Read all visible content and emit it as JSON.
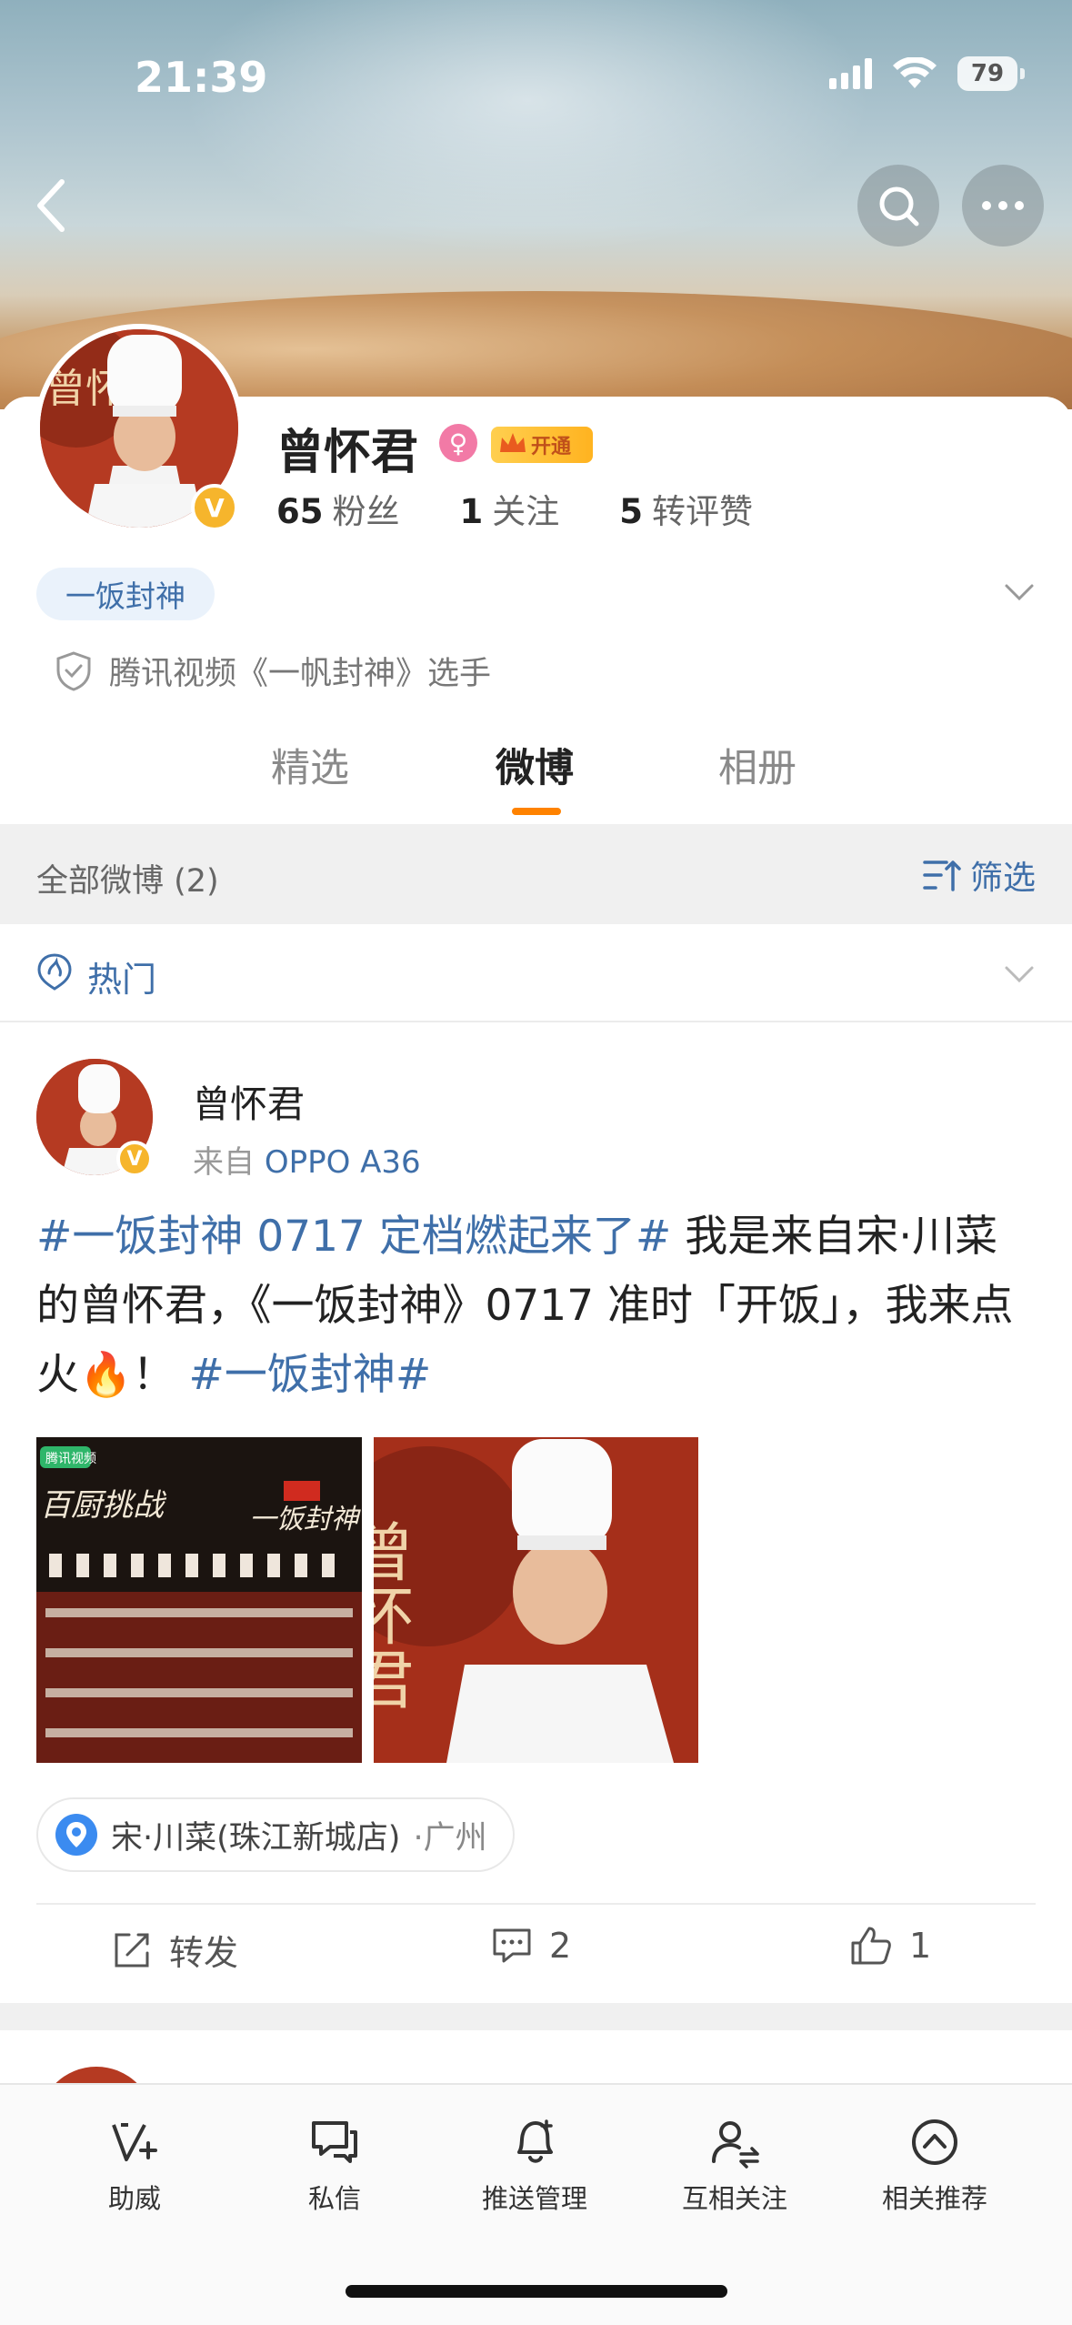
{
  "status_bar": {
    "time": "21:39",
    "battery": "79"
  },
  "profile": {
    "name": "曾怀君",
    "vip_label": "开通",
    "avatar_text": "曾怀",
    "stats": [
      {
        "value": "65",
        "label": "粉丝"
      },
      {
        "value": "1",
        "label": "关注"
      },
      {
        "value": "5",
        "label": "转评赞"
      }
    ],
    "tag": "一饭封神",
    "verification": "腾讯视频《一帆封神》选手"
  },
  "tabs": [
    {
      "label": "精选",
      "active": false
    },
    {
      "label": "微博",
      "active": true
    },
    {
      "label": "相册",
      "active": false
    }
  ],
  "filter_bar": {
    "count_label": "全部微博 (2)",
    "filter_label": "筛选"
  },
  "hot_row": {
    "label": "热门"
  },
  "post": {
    "author": "曾怀君",
    "source_prefix": "来自 ",
    "source_device": "OPPO A36",
    "topic1": "#一饭封神 0717 定档燃起来了#",
    "text1": " 我是来自宋·川菜的曾怀君，《一饭封神》0717 准时「开饭」，我来点火",
    "emoji": "🔥",
    "text2": "！ ",
    "topic2": "#一饭封神#",
    "image1": {
      "title_left": "百厨挑战",
      "title_right": "一饭封神",
      "badge": "腾讯视频"
    },
    "image2": {
      "calligraphy": "曾怀君"
    },
    "location": {
      "place": "宋·川菜(珠江新城店)",
      "city": "·广州"
    },
    "actions": {
      "repost_label": "转发",
      "comments": "2",
      "likes": "1"
    }
  },
  "toolbar": {
    "items": [
      {
        "label": "助威",
        "icon": "cheer-icon"
      },
      {
        "label": "私信",
        "icon": "message-icon"
      },
      {
        "label": "推送管理",
        "icon": "bell-icon"
      },
      {
        "label": "互相关注",
        "icon": "mutual-follow-icon"
      },
      {
        "label": "相关推荐",
        "icon": "recommend-icon"
      }
    ]
  },
  "colors": {
    "accent_blue": "#3f6fa9",
    "tab_underline": "#ff8200",
    "vip_gold": "#ffb320",
    "verified_badge": "#f6b52c"
  }
}
